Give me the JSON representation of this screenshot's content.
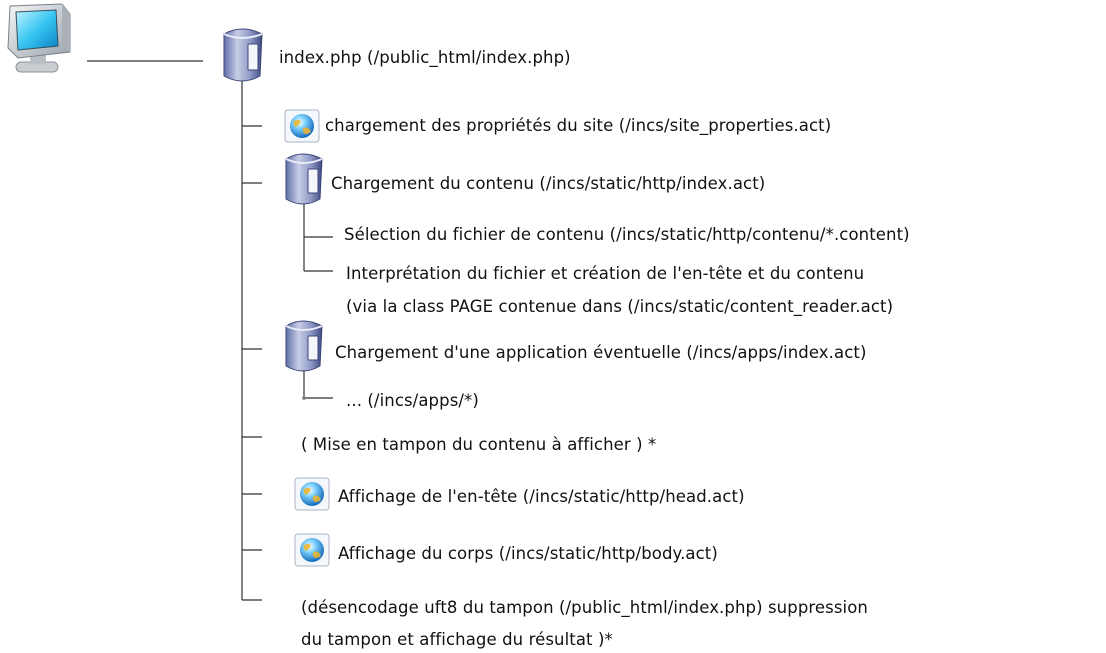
{
  "tree": {
    "root_label": "index.php (/public_html/index.php)",
    "nodes": [
      {
        "id": "n1",
        "icon": "globe-icon",
        "label": "chargement des propriétés du site (/incs/site_properties.act)"
      },
      {
        "id": "n2",
        "icon": "server-icon",
        "label": "Chargement du contenu (/incs/static/http/index.act)"
      },
      {
        "id": "n2a",
        "icon": "",
        "label": "Sélection du fichier de contenu (/incs/static/http/contenu/*.content)"
      },
      {
        "id": "n2b",
        "icon": "",
        "label": "Interprétation du fichier et création de l'en-tête et du contenu"
      },
      {
        "id": "n2b2",
        "icon": "",
        "label": "(via la class PAGE contenue dans (/incs/static/content_reader.act)"
      },
      {
        "id": "n3",
        "icon": "server-icon",
        "label": "Chargement d'une application éventuelle (/incs/apps/index.act)"
      },
      {
        "id": "n3a",
        "icon": "",
        "label": "... (/incs/apps/*)"
      },
      {
        "id": "n4",
        "icon": "",
        "label": "( Mise en tampon du contenu à afficher ) *"
      },
      {
        "id": "n5",
        "icon": "globe-icon",
        "label": "Affichage de l'en-tête (/incs/static/http/head.act)"
      },
      {
        "id": "n6",
        "icon": "globe-icon",
        "label": "Affichage du corps (/incs/static/http/body.act)"
      },
      {
        "id": "n7",
        "icon": "",
        "label": "(désencodage uft8 du tampon (/public_html/index.php) suppression"
      },
      {
        "id": "n7b",
        "icon": "",
        "label": "du tampon et affichage du résultat )*"
      }
    ]
  },
  "colors": {
    "line": "#333333",
    "text": "#111111"
  }
}
